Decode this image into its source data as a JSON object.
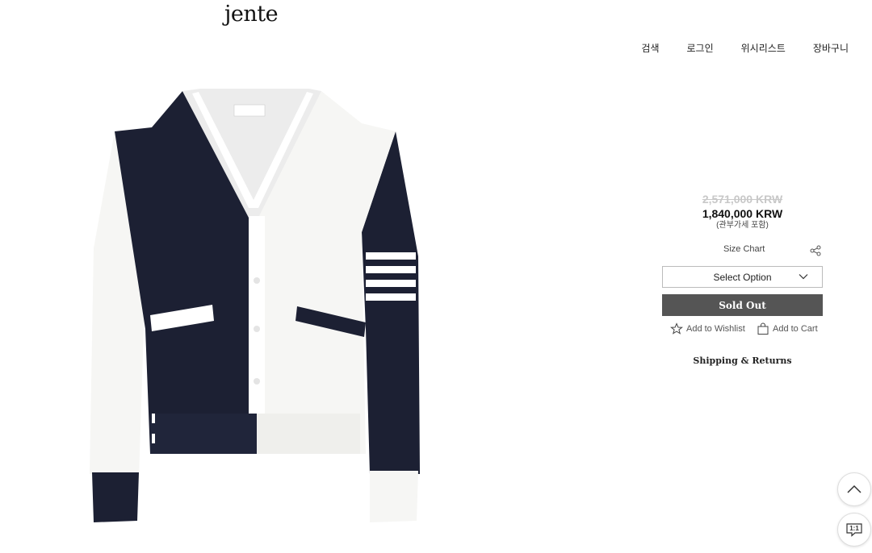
{
  "brand": {
    "logo_text": "jente"
  },
  "nav": [
    "검색",
    "로그인",
    "위시리스트",
    "장바구니"
  ],
  "product": {
    "image_alt": "Thom Browne bicolor V-neck cardigan",
    "original_price": "2,571,000 KRW",
    "sale_price": "1,840,000 KRW",
    "tax_note": "(관부가세 포함)",
    "size_chart_label": "Size Chart",
    "select_placeholder": "Select Option",
    "sold_out_label": "Sold Out",
    "wishlist_label": "Add to Wishlist",
    "cart_label": "Add to Cart",
    "shipping_label": "Shipping & Returns"
  },
  "floating": {
    "chat_label": "1:1"
  },
  "colors": {
    "sold_out_bg": "#555555",
    "navy": "#1c2033",
    "off_white": "#f6f6f4"
  }
}
